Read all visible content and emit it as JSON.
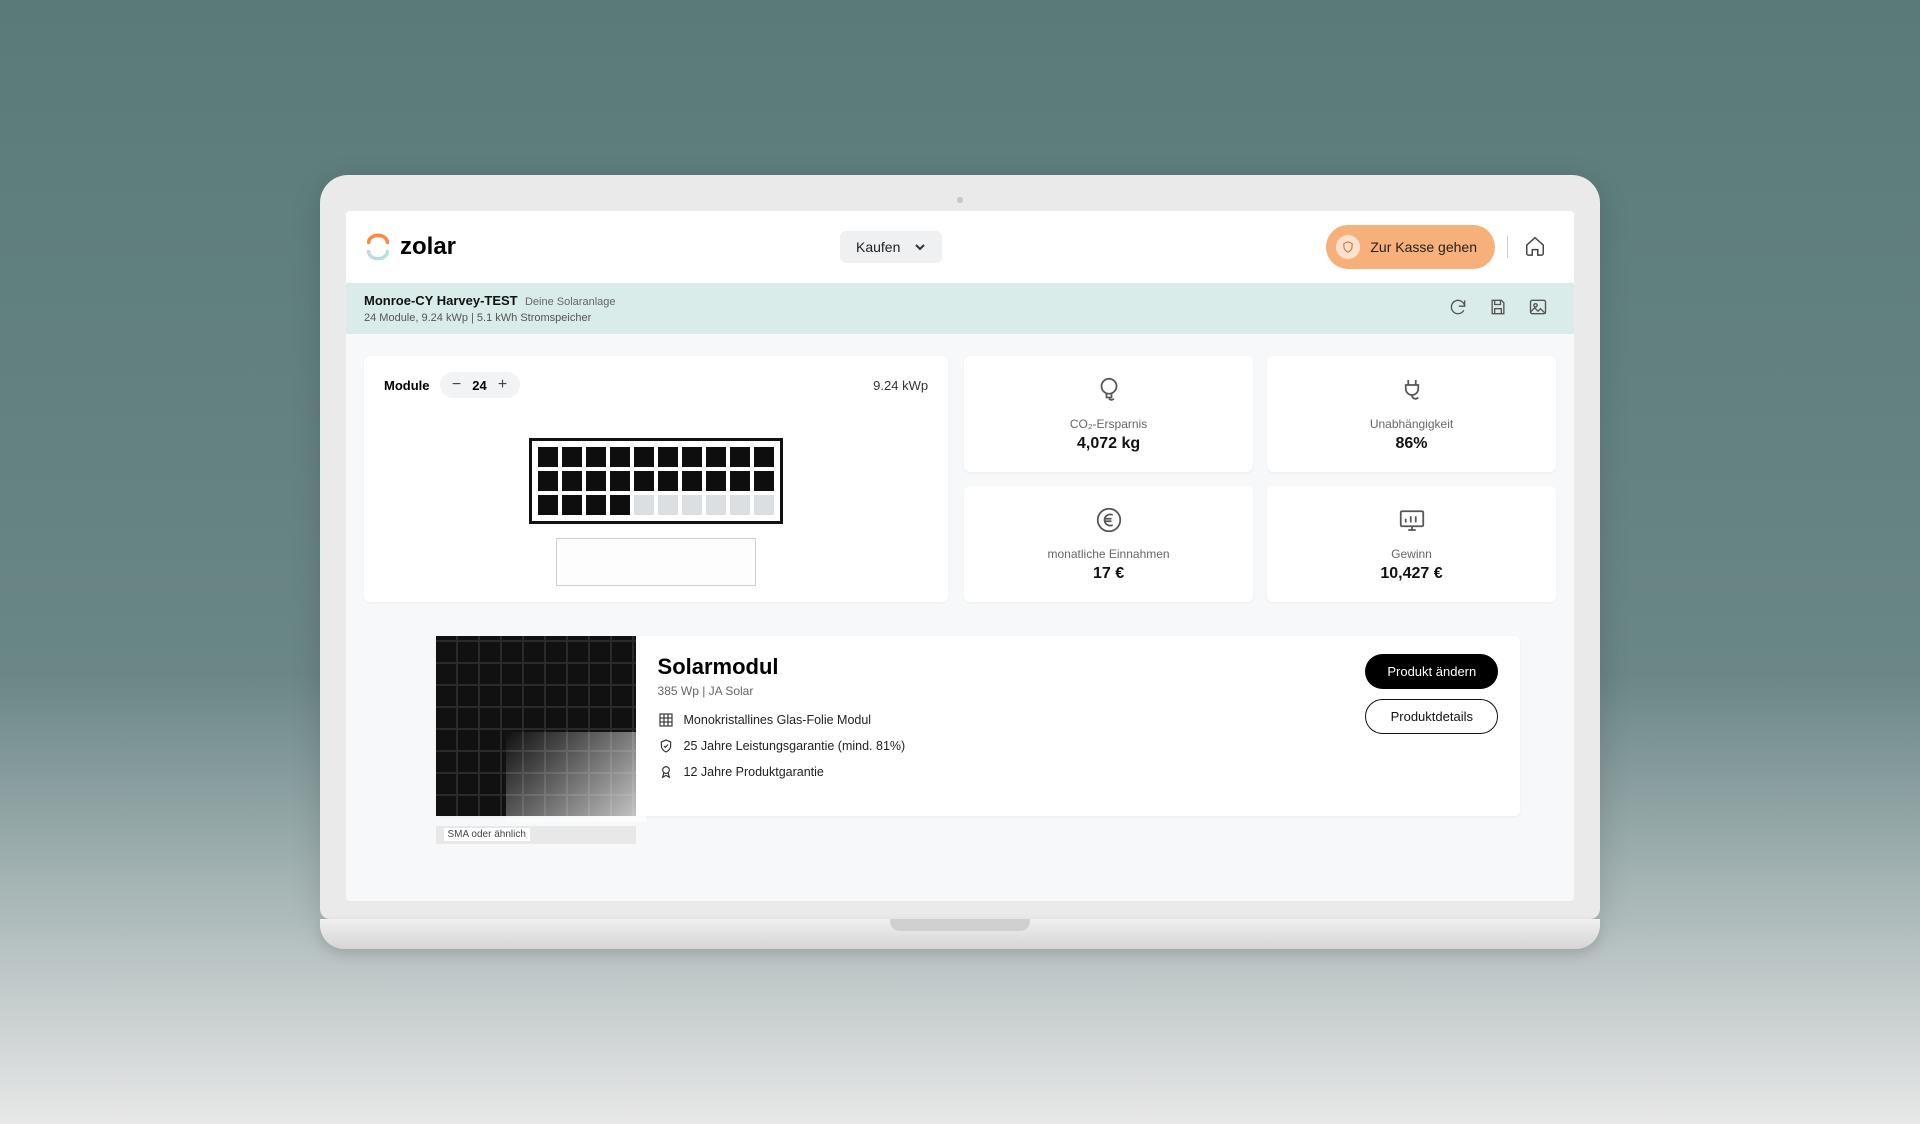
{
  "brand": "zolar",
  "nav": {
    "dropdown_label": "Kaufen"
  },
  "checkout_label": "Zur Kasse gehen",
  "project": {
    "title": "Monroe-CY Harvey-TEST",
    "subtitle": "Deine Solaranlage",
    "spec_line": "24 Module, 9.24 kWp | 5.1 kWh Stromspeicher"
  },
  "config": {
    "module_label": "Module",
    "module_count": "24",
    "kwp": "9.24 kWp",
    "filled_cells": 24,
    "total_cells": 30
  },
  "stats": {
    "co2_label": "CO₂-Ersparnis",
    "co2_value": "4,072 kg",
    "independence_label": "Unabhängigkeit",
    "independence_value": "86%",
    "income_label": "monatliche Einnahmen",
    "income_value": "17 €",
    "profit_label": "Gewinn",
    "profit_value": "10,427 €"
  },
  "product": {
    "title": "Solarmodul",
    "subtitle": "385 Wp | JA Solar",
    "feature1": "Monokristallines Glas-Folie Modul",
    "feature2": "25 Jahre Leistungsgarantie (mind. 81%)",
    "feature3": "12 Jahre Produktgarantie",
    "change_btn": "Produkt ändern",
    "details_btn": "Produktdetails"
  },
  "cutoff_label": "SMA oder ähnlich"
}
